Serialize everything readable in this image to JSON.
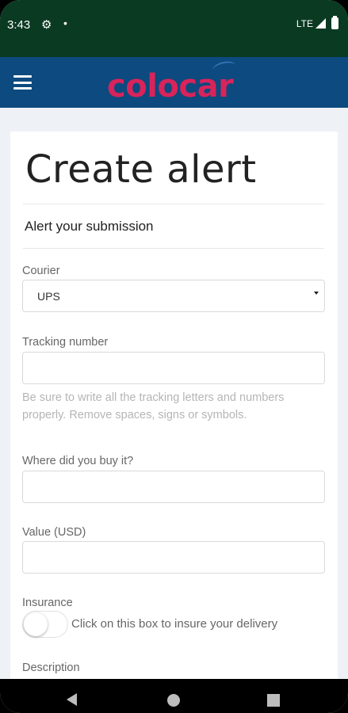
{
  "status_bar": {
    "time": "3:43",
    "network": "LTE"
  },
  "app_bar": {
    "logo": "colocar",
    "brand_color": "#d8245b",
    "bar_color": "#0c4a7f"
  },
  "form": {
    "title": "Create alert",
    "subtitle": "Alert your submission",
    "courier": {
      "label": "Courier",
      "value": "UPS"
    },
    "tracking": {
      "label": "Tracking number",
      "value": "",
      "help": "Be sure to write all the tracking letters and numbers properly. Remove spaces, signs or symbols."
    },
    "where": {
      "label": "Where did you buy it?",
      "value": ""
    },
    "value_usd": {
      "label": "Value (USD)",
      "value": ""
    },
    "insurance": {
      "label": "Insurance",
      "toggle_text": "Click on this box to insure your delivery",
      "checked": false
    },
    "description": {
      "label": "Description"
    }
  },
  "icons": {
    "settings": "gear-icon",
    "menu": "menu-icon",
    "back": "back-icon",
    "home": "home-icon",
    "recent": "recent-apps-icon"
  }
}
